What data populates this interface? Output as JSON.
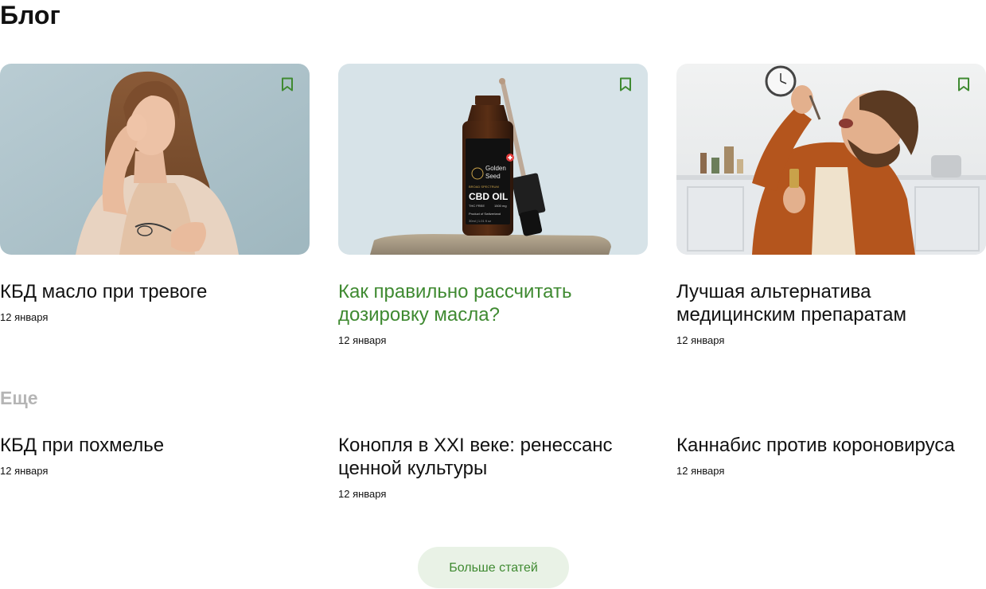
{
  "blog": {
    "title": "Блог"
  },
  "featured": [
    {
      "title": "КБД масло при тревоге",
      "date": "12 января",
      "image": "woman-headache-photo",
      "active": false
    },
    {
      "title": "Как правильно рассчитать дозировку масла?",
      "date": "12 января",
      "image": "cbd-oil-bottle-photo",
      "product_label": {
        "brand_line1": "Golden",
        "brand_line2": "Seed",
        "spectrum": "BROAD SPECTRUM",
        "name": "CBD OIL",
        "thc": "THC FREE",
        "dose": "1500 mg",
        "origin": "Product of Switzerland",
        "volume": "30ml | 1.01 fl oz"
      },
      "active": true
    },
    {
      "title": "Лучшая альтернатива медицинским препаратам",
      "date": "12 января",
      "image": "man-dropper-photo",
      "active": false
    }
  ],
  "more": {
    "label": "Еще",
    "articles": [
      {
        "title": "КБД при похмелье",
        "date": "12 января"
      },
      {
        "title": "Конопля в XXI веке: ренессанс ценной культуры",
        "date": "12 января"
      },
      {
        "title": "Каннабис против короновируса",
        "date": "12 января"
      }
    ]
  },
  "load_more_button": "Больше статей",
  "colors": {
    "accent": "#3f8a31",
    "button_bg": "#e9f2e6",
    "muted": "#b5b5b5"
  },
  "icons": {
    "bookmark": "bookmark-icon"
  }
}
